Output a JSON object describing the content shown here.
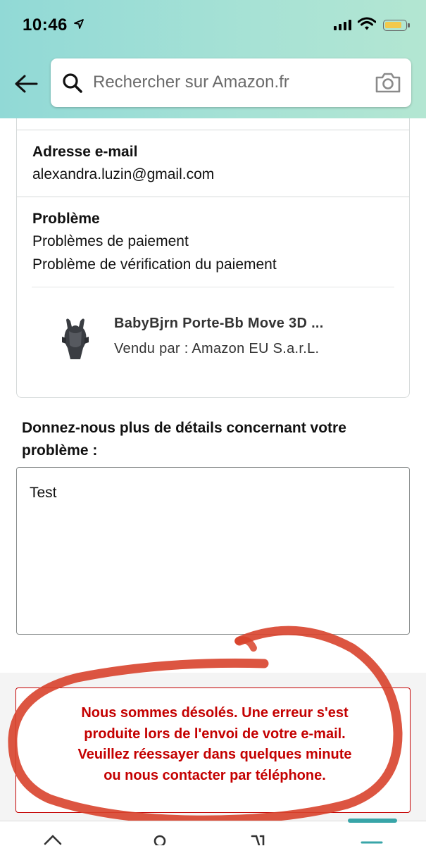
{
  "status": {
    "time": "10:46"
  },
  "search": {
    "placeholder": "Rechercher sur Amazon.fr"
  },
  "email": {
    "label": "Adresse e-mail",
    "value": "alexandra.luzin@gmail.com"
  },
  "problem": {
    "label": "Problème",
    "line1": "Problèmes de paiement",
    "line2": "Problème de vérification du paiement"
  },
  "product": {
    "title": "BabyBjrn Porte-Bb Move 3D ...",
    "seller": "Vendu par : Amazon EU S.a.r.L."
  },
  "details": {
    "question": "Donnez-nous plus de détails concernant votre problème :",
    "text": "Test"
  },
  "error": {
    "line1": "Nous sommes désolés. Une erreur s'est",
    "line2": "produite lors de l'envoi de votre e-mail.",
    "line3": "Veuillez réessayer dans quelques minute",
    "line4": "ou nous contacter par téléphone."
  },
  "colors": {
    "error": "#c40000",
    "header": "#a7e2d5",
    "annotation": "#d8432c"
  }
}
